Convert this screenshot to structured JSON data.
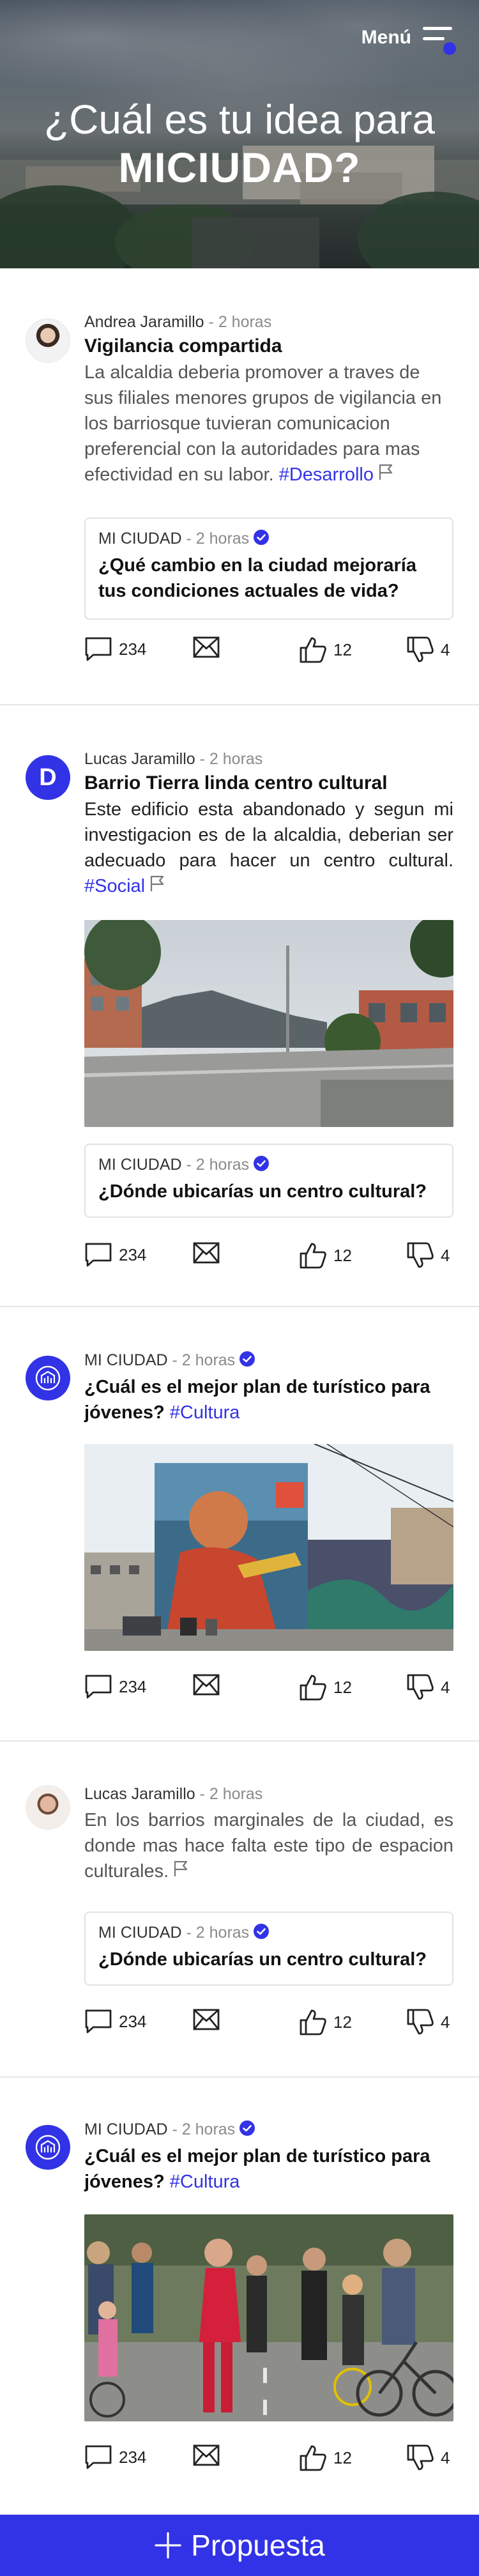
{
  "hero": {
    "menu_label": "Menú",
    "title_line1": "¿Cuál es tu idea para",
    "title_line2": "MICIUDAD?"
  },
  "posts": [
    {
      "author": "Andrea Jaramillo",
      "time": "- 2 horas",
      "title": "Vigilancia compartida",
      "text": "La alcaldia deberia promover a traves de sus filiales menores grupos de vigilancia en los barriosque tuvieran comunicacion preferencial con la autoridades para mas efectividad en su labor.",
      "tag": "#Desarrollo",
      "quote": {
        "author": "MI CIUDAD",
        "time": "- 2 horas",
        "question": "¿Qué cambio en la ciudad mejoraría tus condiciones actuales de vida?"
      },
      "comments": "234",
      "likes": "12",
      "dislikes": "4"
    },
    {
      "author": "Lucas Jaramillo",
      "avatar_letter": "D",
      "time": "- 2 horas",
      "title": "Barrio Tierra linda centro cultural",
      "text": "Este edificio esta abandonado y segun mi investigacion es de la alcaldia, deberian ser adecuado para hacer un centro cultural.",
      "tag": "#Social",
      "quote": {
        "author": "MI CIUDAD",
        "time": "- 2 horas",
        "question": "¿Dónde ubicarías un centro cultural?"
      },
      "comments": "234",
      "likes": "12",
      "dislikes": "4"
    },
    {
      "author": "MI CIUDAD",
      "time": "- 2 horas",
      "question": "¿Cuál es el mejor plan de turístico para jóvenes?",
      "tag": "#Cultura",
      "comments": "234",
      "likes": "12",
      "dislikes": "4"
    },
    {
      "author": "Lucas Jaramillo",
      "time": "- 2 horas",
      "text": "En los barrios marginales de la ciudad, es donde mas hace falta este tipo de espacion culturales.",
      "quote": {
        "author": "MI CIUDAD",
        "time": "- 2 horas",
        "question": "¿Dónde ubicarías un centro cultural?"
      },
      "comments": "234",
      "likes": "12",
      "dislikes": "4"
    },
    {
      "author": "MI CIUDAD",
      "time": "- 2 horas",
      "question": "¿Cuál es el mejor plan de turístico para jóvenes?",
      "tag": "#Cultura",
      "comments": "234",
      "likes": "12",
      "dislikes": "4"
    }
  ],
  "cta": {
    "label": "Propuesta"
  },
  "colors": {
    "accent": "#3232e6",
    "verified": "#3232e6"
  }
}
